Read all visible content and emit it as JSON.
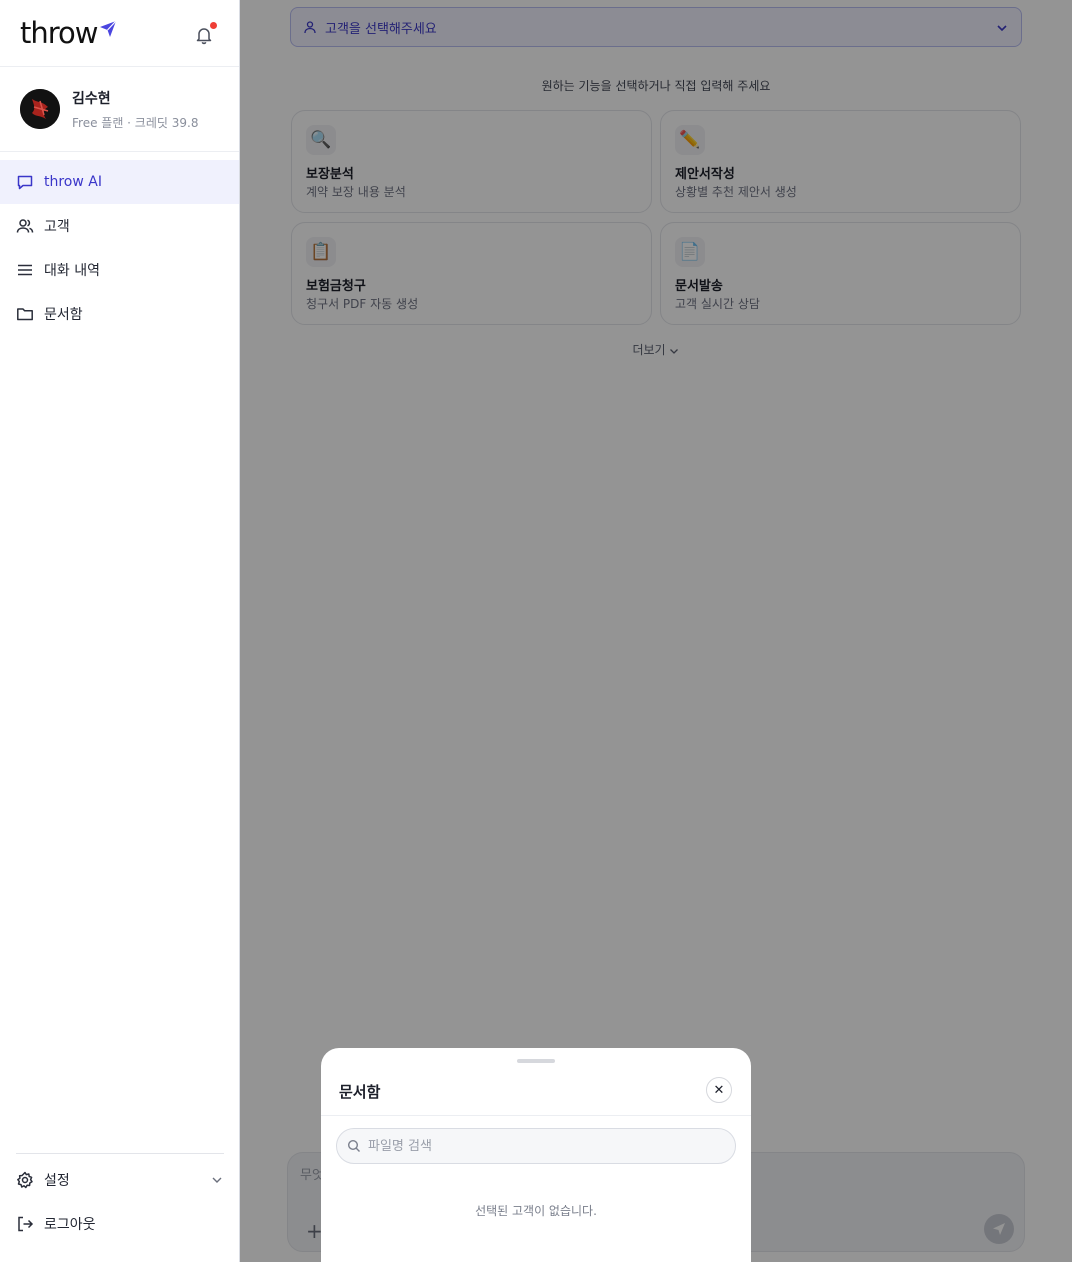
{
  "brand": {
    "name": "throw",
    "accent": "#3a36c9"
  },
  "profile": {
    "name": "김수현",
    "plan": "Free 플랜 · 크레딧 39.8"
  },
  "nav": {
    "items": [
      {
        "label": "throw AI",
        "icon": "chat-icon",
        "active": true
      },
      {
        "label": "고객",
        "icon": "users-icon"
      },
      {
        "label": "대화 내역",
        "icon": "list-icon"
      },
      {
        "label": "문서함",
        "icon": "folder-icon"
      }
    ]
  },
  "footer": {
    "settings_label": "설정",
    "logout_label": "로그아웃"
  },
  "main": {
    "customer_placeholder": "고객을 선택해주세요",
    "hint": "원하는 기능을 선택하거나 직접 입력해 주세요",
    "cards": [
      {
        "emoji": "🔍",
        "title": "보장분석",
        "desc": "계약 보장 내용 분석"
      },
      {
        "emoji": "✏️",
        "title": "제안서작성",
        "desc": "상황별 추천 제안서 생성"
      },
      {
        "emoji": "📋",
        "title": "보험금청구",
        "desc": "청구서 PDF 자동 생성"
      },
      {
        "emoji": "📄",
        "title": "문서발송",
        "desc": "고객 실시간 상담"
      }
    ],
    "more_label": "더보기",
    "composer_placeholder": "무엇",
    "composer_plus": "+"
  },
  "sheet": {
    "title": "문서함",
    "close_glyph": "✕",
    "search_placeholder": "파일명 검색",
    "empty_text": "선택된 고객이 없습니다."
  }
}
